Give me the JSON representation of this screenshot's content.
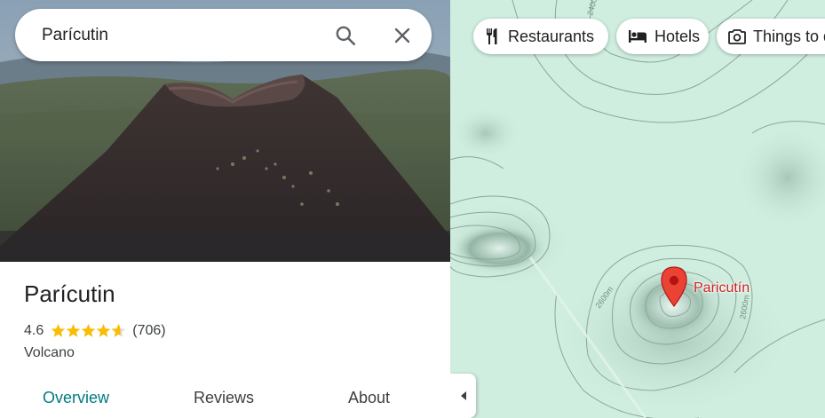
{
  "search": {
    "value": "Parícutin"
  },
  "place": {
    "title": "Parícutin",
    "rating": "4.6",
    "stars": 4.6,
    "review_count": "(706)",
    "category": "Volcano"
  },
  "tabs": [
    {
      "label": "Overview",
      "active": true
    },
    {
      "label": "Reviews",
      "active": false
    },
    {
      "label": "About",
      "active": false
    }
  ],
  "map": {
    "chips": [
      {
        "label": "Restaurants",
        "icon": "fork-knife-icon"
      },
      {
        "label": "Hotels",
        "icon": "bed-icon"
      },
      {
        "label": "Things to do",
        "icon": "camera-icon"
      }
    ],
    "pin_label": "Paricutín",
    "contour_labels": [
      "2600m",
      "2600m",
      "2400"
    ]
  },
  "colors": {
    "accent": "#007b83",
    "star": "#fbbc04",
    "pin": "#ea4335",
    "pin_label": "#c5221f",
    "map_bg": "#cfeee0"
  }
}
